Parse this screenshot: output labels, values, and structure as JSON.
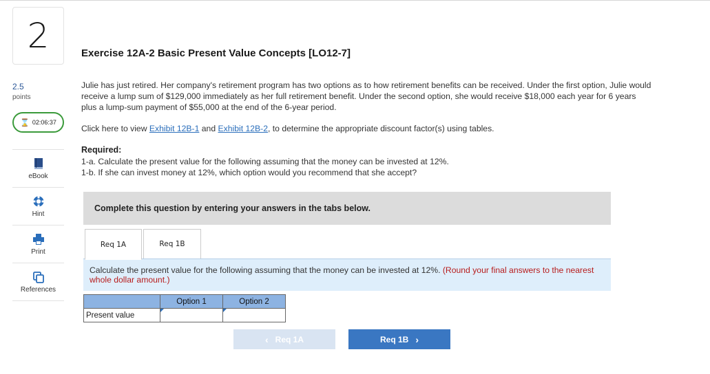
{
  "question": {
    "number": "2",
    "points_value": "2.5",
    "points_label": "points",
    "timer": "02:06:37"
  },
  "rail": {
    "items": [
      {
        "label": "eBook",
        "icon": "book-icon"
      },
      {
        "label": "Hint",
        "icon": "lifebuoy-icon"
      },
      {
        "label": "Print",
        "icon": "printer-icon"
      },
      {
        "label": "References",
        "icon": "copy-icon"
      }
    ]
  },
  "exercise": {
    "title": "Exercise 12A-2 Basic Present Value Concepts [LO12-7]",
    "paragraph": "Julie has just retired. Her company's retirement program has two options as to how retirement benefits can be received. Under the first option, Julie would receive a lump sum of $129,000 immediately as her full retirement benefit. Under the second option, she would receive $18,000 each year for 6 years plus a lump-sum payment of $55,000 at the end of the 6-year period.",
    "click_prefix": "Click here to view ",
    "exhibit1": "Exhibit 12B-1",
    "click_and": " and ",
    "exhibit2": "Exhibit 12B-2",
    "click_suffix": ", to determine the appropriate discount factor(s) using tables.",
    "required_heading": "Required:",
    "req_1a": "1-a. Calculate the present value for the following assuming that the money can be invested at 12%.",
    "req_1b": "1-b. If she can invest money at 12%, which option would you recommend that she accept?"
  },
  "panel": {
    "complete_text": "Complete this question by entering your answers in the tabs below.",
    "tabs": [
      {
        "label": "Req 1A"
      },
      {
        "label": "Req 1B"
      }
    ],
    "instruction": "Calculate the present value for the following assuming that the money can be invested at 12%. ",
    "instruction_round": "(Round your final answers to the nearest whole dollar amount.)"
  },
  "table": {
    "col1": "Option 1",
    "col2": "Option 2",
    "row_label": "Present value",
    "option1_value": "",
    "option2_value": ""
  },
  "nav": {
    "prev_label": "Req 1A",
    "next_label": "Req 1B",
    "prev_chevron": "‹",
    "next_chevron": "›"
  }
}
